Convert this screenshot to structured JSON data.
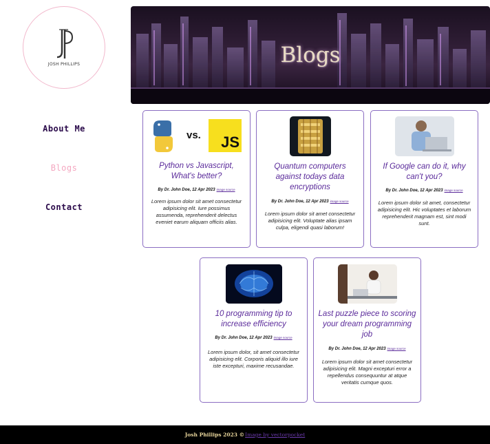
{
  "logo": {
    "text": "JOSH PHILLIPS"
  },
  "nav": {
    "items": [
      {
        "label": "About Me"
      },
      {
        "label": "Blogs"
      },
      {
        "label": "Contact"
      }
    ]
  },
  "banner": {
    "title": "Blogs"
  },
  "cards": [
    {
      "title": "Python vs Javascript, What's better?",
      "meta": "By Dr. John Doe, 12 Apr 2023",
      "source": "image source",
      "body": "Lorem ipsum dolor sit amet consectetur adipisicing elit. Iure possimus assumenda, reprehenderit delectus eveniet earum aliquam officiis alias.",
      "vs_text": "vs.",
      "js_text": "JS"
    },
    {
      "title": "Quantum computers against todays data encryptions",
      "meta": "By Dr. John Doe, 12 Apr 2023",
      "source": "image source",
      "body": "Lorem ipsum dolor sit amet consectetur adipisicing elit. Voluptate alias ipsam culpa, eligendi quasi laborum!"
    },
    {
      "title": "If Google can do it, why can't you?",
      "meta": "By Dr. John Doe, 12 Apr 2023",
      "source": "image source",
      "body": "Lorem ipsum dolor sit amet, consectetur adipisicing elit. Hic voluptates et laborum reprehenderit magnam est, sint modi sunt."
    },
    {
      "title": "10 programming tip to increase efficiency",
      "meta": "By Dr. John Doe, 12 Apr 2023",
      "source": "image source",
      "body": "Lorem ipsum dolor, sit amet consectetur adipisicing elit. Corporis aliquid illo iure iste excepturi, maxime recusandae."
    },
    {
      "title": "Last puzzle piece to scoring your dream programming job",
      "meta": "By Dr. John Doe, 12 Apr 2023",
      "source": "image source",
      "body": "Lorem ipsum dolor sit amet consectetur adipisicing elit. Magni excepturi error a repellendus consequuntur at atque veritatis cumque quos."
    }
  ],
  "footer": {
    "text": "Josh Phillips 2023 ©",
    "credit": "Image by vectorpocket"
  },
  "colors": {
    "accent": "#5a2a9a",
    "card_border": "#8a6cc2",
    "nav_active": "#f4a7c0",
    "nav": "#2a0a4a",
    "footer_bg": "#000000"
  }
}
